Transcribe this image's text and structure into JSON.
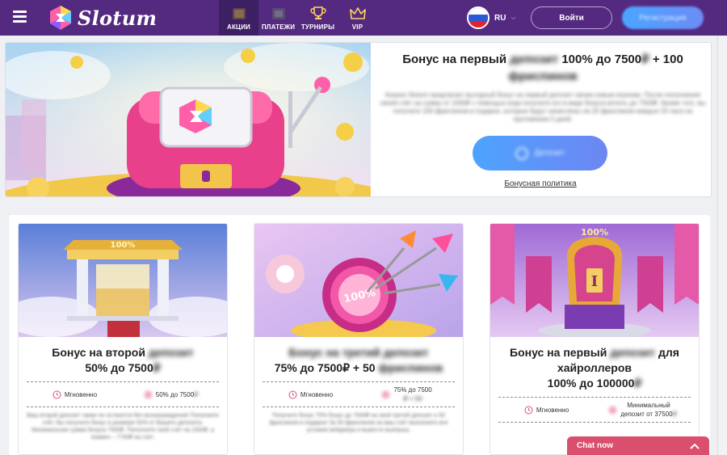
{
  "header": {
    "menu_icon": "hamburger-icon",
    "logo_text": "Slotum",
    "nav": [
      {
        "label": "АКЦИИ",
        "icon": "gift-icon",
        "active": true
      },
      {
        "label": "ПЛАТЕЖИ",
        "icon": "wallet-icon",
        "active": false
      },
      {
        "label": "ТУРНИРЫ",
        "icon": "trophy-icon",
        "active": false
      },
      {
        "label": "VIP",
        "icon": "crown-icon",
        "active": false
      }
    ],
    "language": {
      "code": "RU",
      "flag": "russia-flag-icon"
    },
    "login_label": "Войти",
    "register_label": "Регистрация"
  },
  "hero": {
    "title_a": "Бонус на первый",
    "title_blur": "депозит",
    "title_b": "100% до 7500",
    "title_blur2": "₽",
    "title_c": "+ 100",
    "title_blur3": "фриспинов",
    "description": "Казино Slotum предлагает выгодный бонус на первый депозит своим новым игрокам. После пополнения своей счёт на сумму от 1000₽ с помощью кода получите его в виде бонуса вплоть до 7500₽. Кроме того, вы получите 100 фриспинов в подарок, которые будут начислены на 20 фриспинов каждые 24 часа на протяжении 5 дней.",
    "deposit_button": "Депозит",
    "policy_link": "Бонусная политика"
  },
  "cards": [
    {
      "title_line1_a": "Бонус на второй",
      "title_line1_blur": "депозит",
      "title_line2": "50% до 7500",
      "title_line2_blur": "₽",
      "meta_left": "Мгновенно",
      "meta_right": "50% до 7500",
      "meta_right_blur": "₽",
      "description": "Ваш второй депозит также не останется без вознаграждения! Пополните счёт. Вы получите бонус в размере 50% от Вашего депозита. Минимальная сумма бонуса 7500₽. Пополните свой счёт на 1500₽, а взамен – 7750₽ на счет."
    },
    {
      "title_line1_blur": "Бонус на третий депозит",
      "title_line2": "75% до 7500₽ + 50",
      "title_line2_blur": "фриспинов",
      "meta_left": "Мгновенно",
      "meta_right_a": "75% до 7500",
      "meta_right_blur": "₽ + 50",
      "description": "Получите бонус 75% бонус до 7500₽ на свой третий депозит и 50 фриспинов в подарок! За 50 фриспинов на ваш счёт выполните все условия вейджера и вывести выигрыш."
    },
    {
      "title_line1_a": "Бонус на первый",
      "title_line1_blur": "депозит",
      "title_line1_b": "для",
      "title_line2": "хайроллеров",
      "title_line3": "100% до 100000",
      "title_line3_blur": "₽",
      "meta_left": "Мгновенно",
      "meta_right_a": "Минимальный",
      "meta_right_b": "депозит от 37500",
      "meta_right_blur": "₽"
    }
  ],
  "chat": {
    "label": "Chat now",
    "icon": "chevron-up-icon"
  },
  "colors": {
    "topbar": "#532a80",
    "nav_active": "#3d1f63",
    "chat": "#d94f6d",
    "accent_blue": "#4da3ff"
  }
}
